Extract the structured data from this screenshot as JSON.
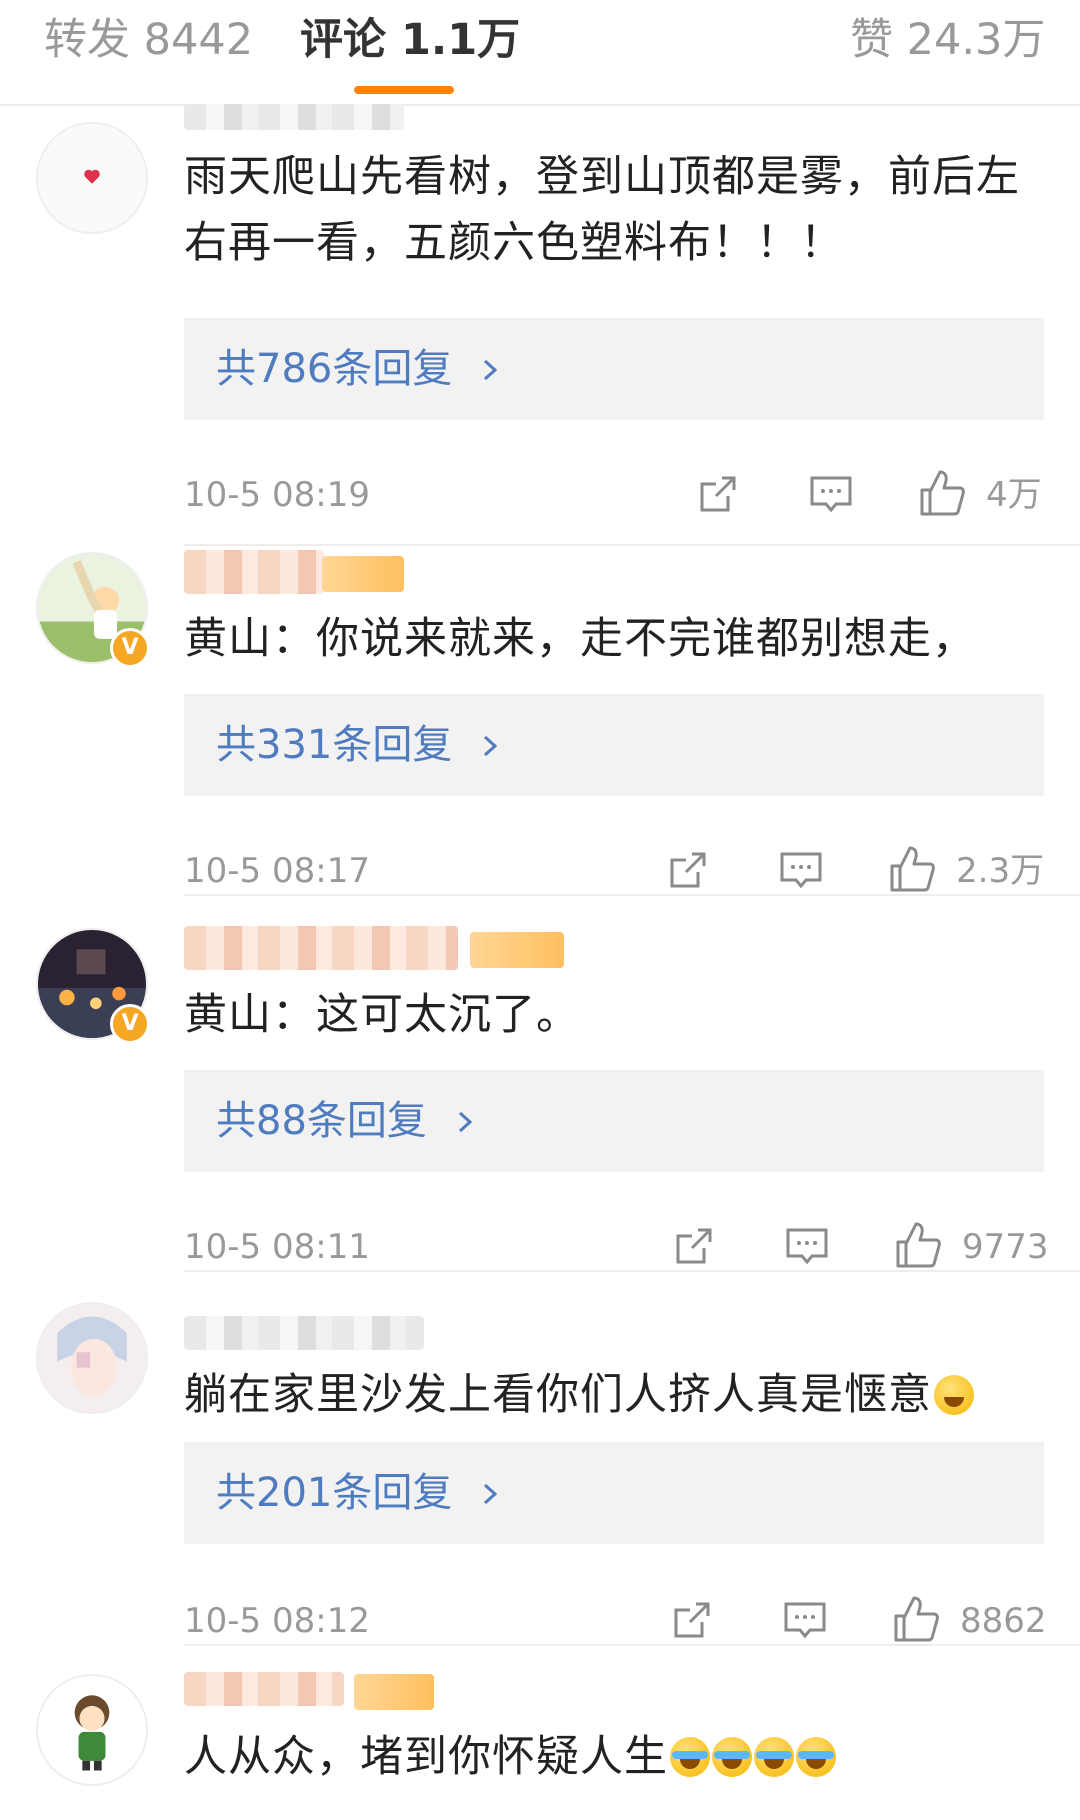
{
  "tabs": {
    "repost": "转发 8442",
    "comments": "评论 1.1万",
    "likes": "赞 24.3万",
    "active": "comments",
    "accent": "#ff8200"
  },
  "comments": [
    {
      "text": "雨天爬山先看树，登到山顶都是雾，前后左右再一看，五颜六色塑料布！！！",
      "replies": "共786条回复",
      "time": "10-5 08:19",
      "likes": "4万",
      "verified": false
    },
    {
      "text": "黄山：你说来就来，走不完谁都别想走，",
      "replies": "共331条回复",
      "time": "10-5 08:17",
      "likes": "2.3万",
      "verified": true
    },
    {
      "text": "黄山：这可太沉了。",
      "replies": "共88条回复",
      "time": "10-5 08:11",
      "likes": "9773",
      "verified": true
    },
    {
      "text": "躺在家里沙发上看你们人挤人真是惬意",
      "emoji_count": 1,
      "replies": "共201条回复",
      "time": "10-5 08:12",
      "likes": "8862",
      "verified": false
    },
    {
      "text": "人从众，堵到你怀疑人生",
      "emoji_count": 4,
      "verified": false
    }
  ],
  "icons": {
    "share": "share-icon",
    "comment": "comment-icon",
    "like": "thumbs-up-icon",
    "chevron": "chevron-right-icon",
    "verified": "verified-v-icon"
  },
  "colors": {
    "link_blue": "#4f7bbf",
    "verified_badge": "#f5a623",
    "reply_box_bg": "#f2f2f2"
  },
  "verified_mark": "V"
}
